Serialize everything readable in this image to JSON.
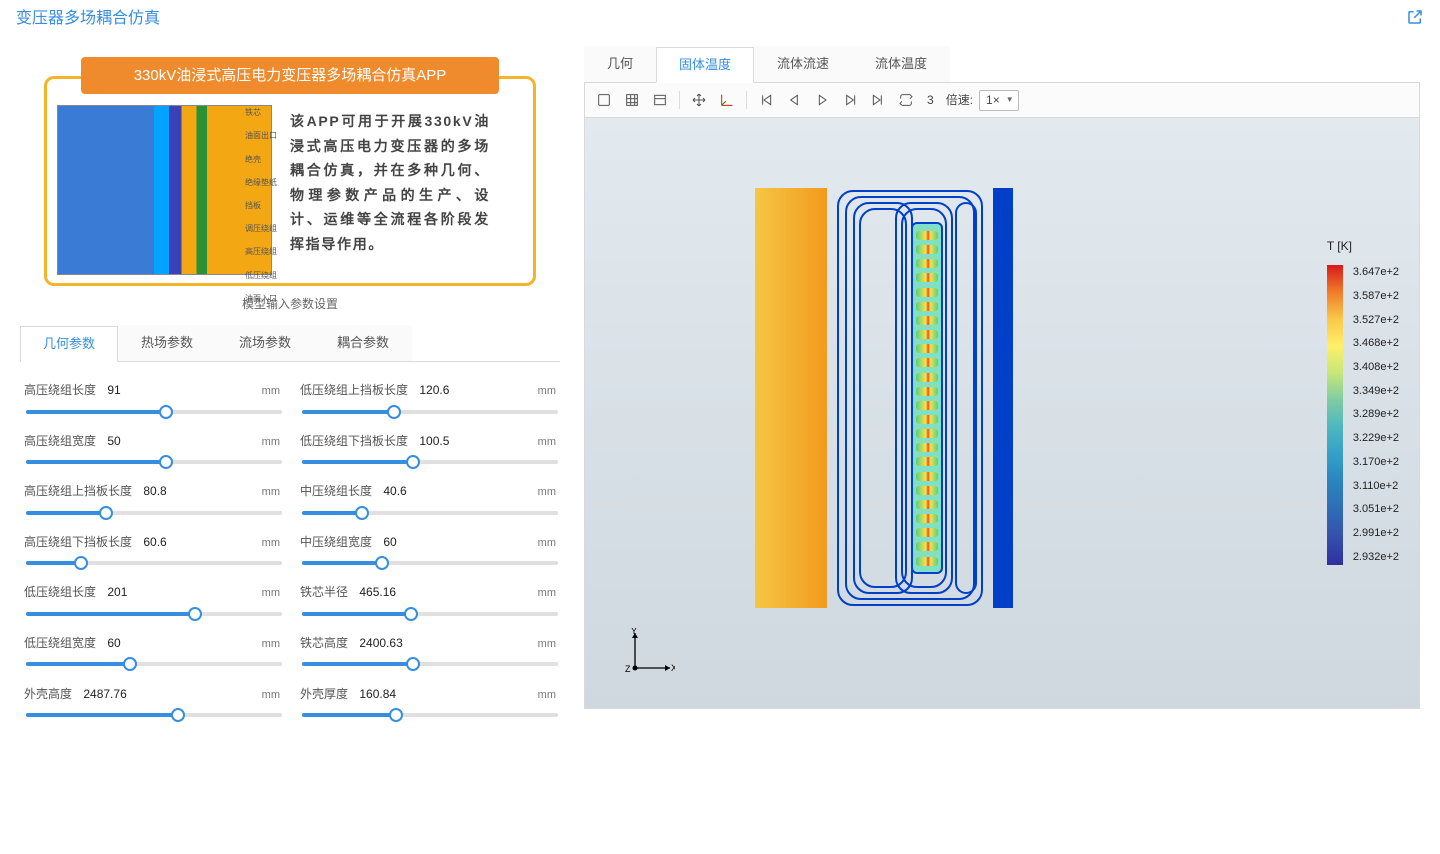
{
  "header": {
    "title": "变压器多场耦合仿真"
  },
  "intro": {
    "title": "330kV油浸式高压电力变压器多场耦合仿真APP",
    "text": "该APP可用于开展330kV油浸式高压电力变压器的多场耦合仿真，并在多种几何、物理参数产品的生产、设计、运维等全流程各阶段发挥指导作用。",
    "caption": "模型输入参数设置",
    "labels": [
      "铁芯",
      "油面出口",
      "绝壳",
      "绝缘垫纸",
      "挡板",
      "调压绕组",
      "高压绕组",
      "低压绕组",
      "油面入口"
    ]
  },
  "param_tabs": [
    "几何参数",
    "热场参数",
    "流场参数",
    "耦合参数"
  ],
  "param_tab_active": 0,
  "params": [
    {
      "name": "高压绕组长度",
      "value": "91",
      "unit": "mm",
      "fill": 55
    },
    {
      "name": "低压绕组上挡板长度",
      "value": "120.6",
      "unit": "mm",
      "fill": 35
    },
    {
      "name": "高压绕组宽度",
      "value": "50",
      "unit": "mm",
      "fill": 55
    },
    {
      "name": "低压绕组下挡板长度",
      "value": "100.5",
      "unit": "mm",
      "fill": 43
    },
    {
      "name": "高压绕组上挡板长度",
      "value": "80.8",
      "unit": "mm",
      "fill": 30
    },
    {
      "name": "中压绕组长度",
      "value": "40.6",
      "unit": "mm",
      "fill": 22
    },
    {
      "name": "高压绕组下挡板长度",
      "value": "60.6",
      "unit": "mm",
      "fill": 20
    },
    {
      "name": "中压绕组宽度",
      "value": "60",
      "unit": "mm",
      "fill": 30
    },
    {
      "name": "低压绕组长度",
      "value": "201",
      "unit": "mm",
      "fill": 67
    },
    {
      "name": "铁芯半径",
      "value": "465.16",
      "unit": "mm",
      "fill": 42
    },
    {
      "name": "低压绕组宽度",
      "value": "60",
      "unit": "mm",
      "fill": 40
    },
    {
      "name": "铁芯高度",
      "value": "2400.63",
      "unit": "mm",
      "fill": 43
    },
    {
      "name": "外壳高度",
      "value": "2487.76",
      "unit": "mm",
      "fill": 60
    },
    {
      "name": "外壳厚度",
      "value": "160.84",
      "unit": "mm",
      "fill": 36
    }
  ],
  "viz_tabs": [
    "几何",
    "固体温度",
    "流体流速",
    "流体温度"
  ],
  "viz_tab_active": 1,
  "playback": {
    "frame": "3",
    "speed_label": "倍速:",
    "speed_value": "1×"
  },
  "legend": {
    "title": "T [K]",
    "ticks": [
      "3.647e+2",
      "3.587e+2",
      "3.527e+2",
      "3.468e+2",
      "3.408e+2",
      "3.349e+2",
      "3.289e+2",
      "3.229e+2",
      "3.170e+2",
      "3.110e+2",
      "3.051e+2",
      "2.991e+2",
      "2.932e+2"
    ]
  },
  "axis": {
    "x": "X",
    "y": "Y",
    "z": "Z"
  }
}
